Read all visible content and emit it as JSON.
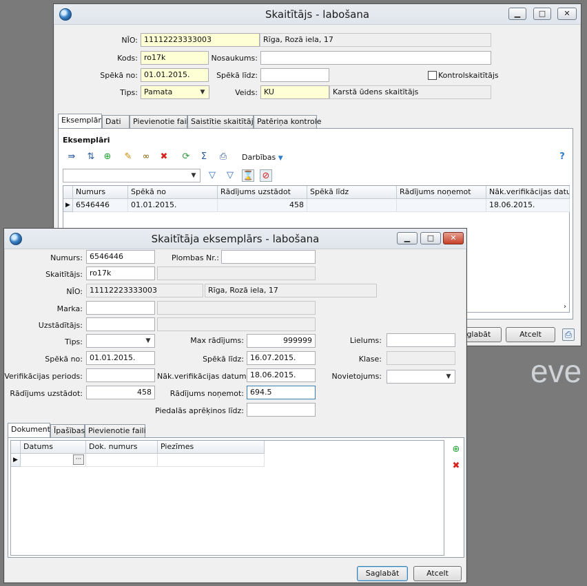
{
  "main": {
    "title": "Skaitītājs - labošana",
    "nio_label": "NĪO:",
    "nio_value": "11112223333003",
    "nio_address": "Rīga, Rozā iela, 17",
    "kods_label": "Kods:",
    "kods_value": "ro17k",
    "nosaukums_label": "Nosaukums:",
    "nosaukums_value": "",
    "speka_no_label": "Spēkā no:",
    "speka_no_value": "01.01.2015.",
    "speka_lidz_label": "Spēkā līdz:",
    "speka_lidz_value": "",
    "kontrol_label": "Kontrolskaitītājs",
    "tips_label": "Tips:",
    "tips_value": "Pamata",
    "veids_label": "Veids:",
    "veids_code": "KU",
    "veids_desc": "Karstā ūdens skaitītājs",
    "tabs": [
      "Eksemplāri",
      "Dati",
      "Pievienotie faili",
      "Saistītie skaitītāji",
      "Patēriņa kontrole"
    ],
    "section_title": "Eksemplāri",
    "actions_label": "Darbības",
    "grid": {
      "headers": [
        "Numurs",
        "Spēkā no",
        "Rādījums uzstādot",
        "Spēkā līdz",
        "Rādījums noņemot",
        "Nāk.verifikācijas datums"
      ],
      "rows": [
        [
          "6546446",
          "01.01.2015.",
          "458",
          "",
          "",
          "18.06.2015."
        ]
      ]
    },
    "save_label": "Saglabāt",
    "cancel_label": "Atcelt"
  },
  "dialog": {
    "title": "Skaitītāja eksemplārs - labošana",
    "numurs_label": "Numurs:",
    "numurs_value": "6546446",
    "plombas_label": "Plombas Nr.:",
    "plombas_value": "",
    "skaititajs_label": "Skaitītājs:",
    "skaititajs_value": "ro17k",
    "nio_label": "NĪO:",
    "nio_value": "11112223333003",
    "nio_address": "Rīga, Rozā iela, 17",
    "marka_label": "Marka:",
    "uzstaditajs_label": "Uzstādītājs:",
    "tips_label": "Tips:",
    "max_label": "Max rādījums:",
    "max_value": "999999",
    "lielums_label": "Lielums:",
    "speka_no_label": "Spēkā no:",
    "speka_no_value": "01.01.2015.",
    "speka_lidz_label": "Spēkā līdz:",
    "speka_lidz_value": "16.07.2015.",
    "klase_label": "Klase:",
    "verif_label": "Verifikācijas periods:",
    "nak_verif_label": "Nāk.verifikācijas datums:",
    "nak_verif_value": "18.06.2015.",
    "novietojums_label": "Novietojums:",
    "rad_uzst_label": "Rādījums uzstādot:",
    "rad_uzst_value": "458",
    "rad_non_label": "Rādījums noņemot:",
    "rad_non_value": "694.5",
    "piedalas_label": "Piedalās aprēķinos līdz:",
    "tabs": [
      "Dokumenti",
      "Īpašības",
      "Pievienotie faili"
    ],
    "doc_grid": {
      "headers": [
        "Datums",
        "Dok. numurs",
        "Piezīmes"
      ]
    },
    "ellipsis": "···",
    "save_label": "Saglabāt",
    "cancel_label": "Atcelt"
  },
  "watermark": "eve"
}
